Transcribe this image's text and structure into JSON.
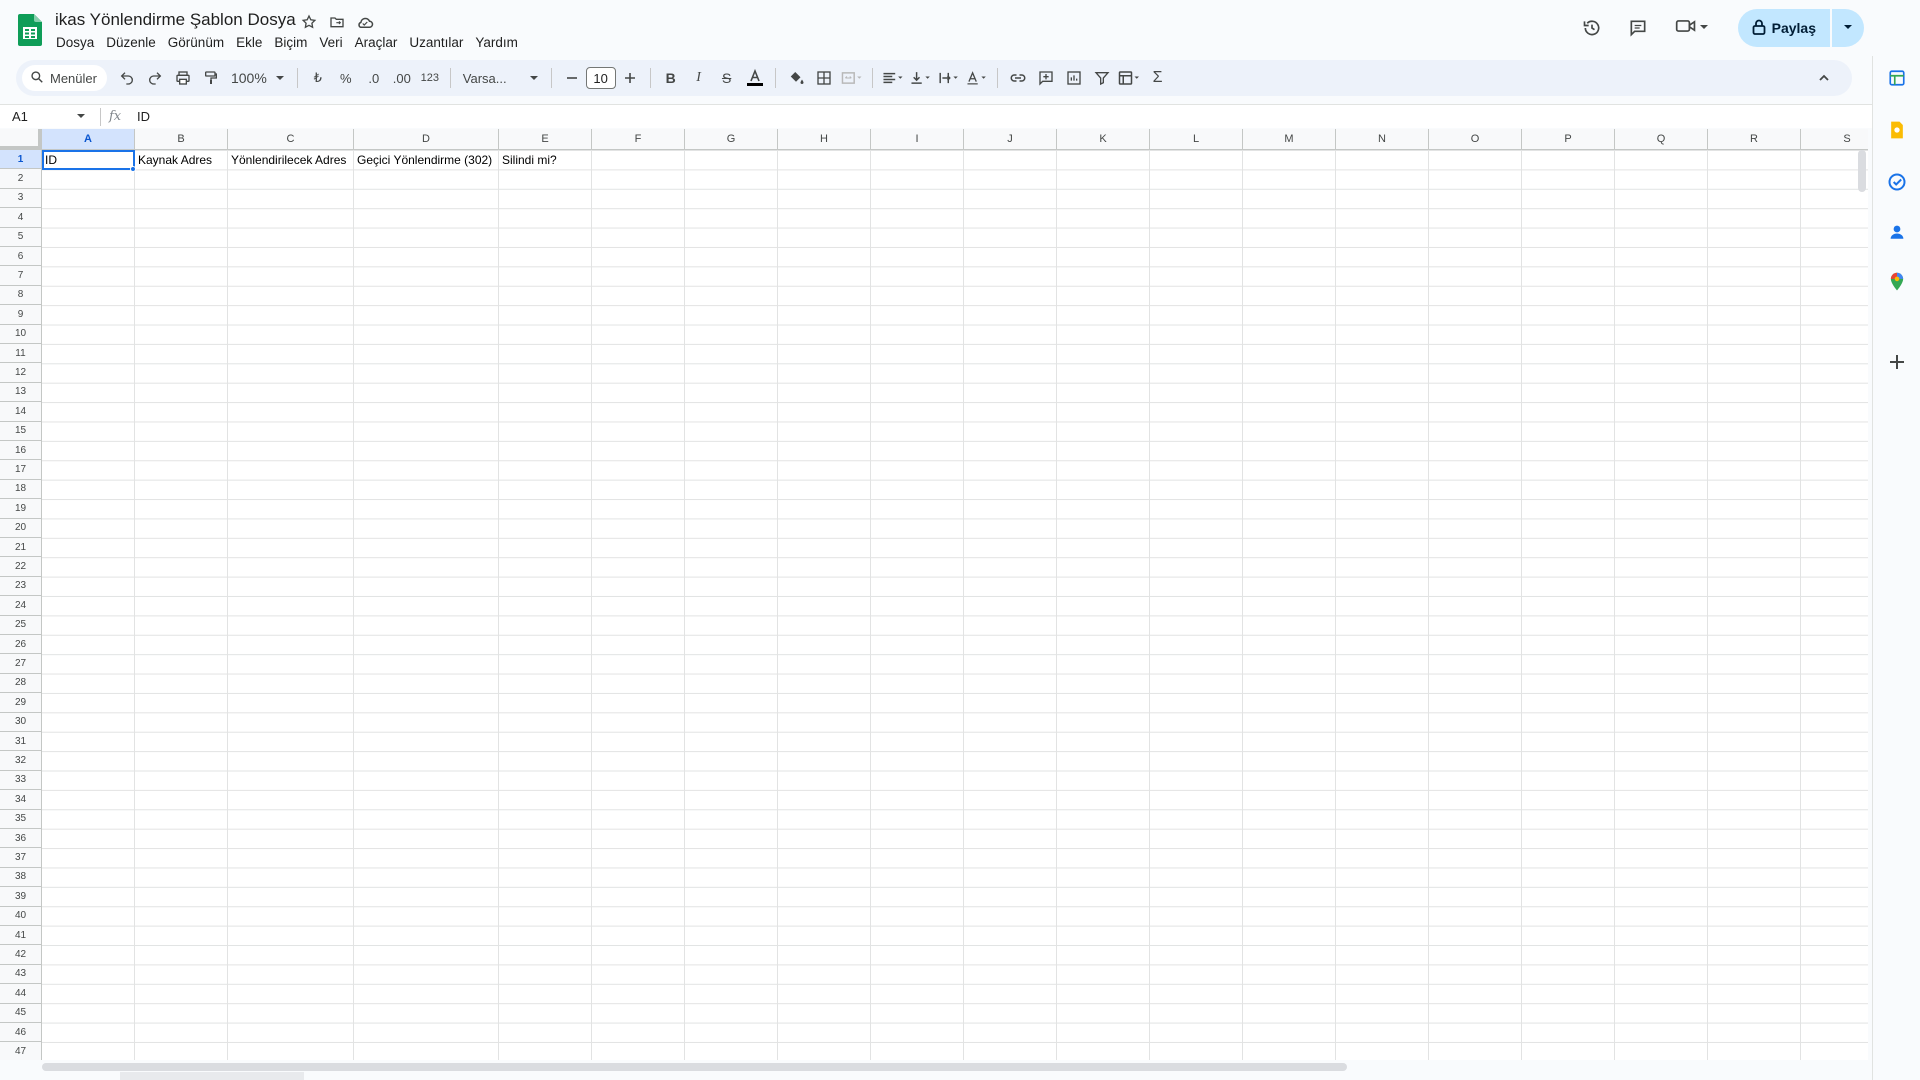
{
  "window": {
    "title": "ikas Yönlendirme Şablon Dosya"
  },
  "menu": [
    "Dosya",
    "Düzenle",
    "Görünüm",
    "Ekle",
    "Biçim",
    "Veri",
    "Araçlar",
    "Uzantılar",
    "Yardım"
  ],
  "share": {
    "label": "Paylaş"
  },
  "toolbar": {
    "search_label": "Menüler",
    "zoom": "100%",
    "currency": "₺",
    "percent": "%",
    "dec_decrease": ".0",
    "dec_increase": ".00",
    "format_num": "123",
    "font": "Varsa...",
    "font_size": "10"
  },
  "formula_bar": {
    "cell_ref": "A1",
    "fx": "fx",
    "value": "ID"
  },
  "columns": [
    "A",
    "B",
    "C",
    "D",
    "E",
    "F",
    "G",
    "H",
    "I",
    "J",
    "K",
    "L",
    "M",
    "N",
    "O",
    "P",
    "Q",
    "R",
    "S"
  ],
  "rows": [
    "1",
    "2",
    "3",
    "4",
    "5",
    "6",
    "7",
    "8",
    "9",
    "10",
    "11",
    "12",
    "13",
    "14",
    "15",
    "16",
    "17",
    "18",
    "19",
    "20",
    "21",
    "22",
    "23",
    "24",
    "25",
    "26",
    "27",
    "28",
    "29",
    "30",
    "31",
    "32",
    "33",
    "34",
    "35",
    "36",
    "37",
    "38",
    "39",
    "40",
    "41",
    "42",
    "43",
    "44",
    "45",
    "46",
    "47"
  ],
  "cells": {
    "A1": "ID",
    "B1": "Kaynak Adres",
    "C1": "Yönlendirilecek Adres",
    "D1": "Geçici Yönlendirme (302)",
    "E1": "Silindi mi?"
  },
  "selected": {
    "column": "A",
    "row": "1"
  },
  "colors": {
    "accent": "#1a73e8",
    "share_bg": "#c2e7ff",
    "toolbar_bg": "#edf2fa",
    "sheets_green": "#0f9d58"
  }
}
